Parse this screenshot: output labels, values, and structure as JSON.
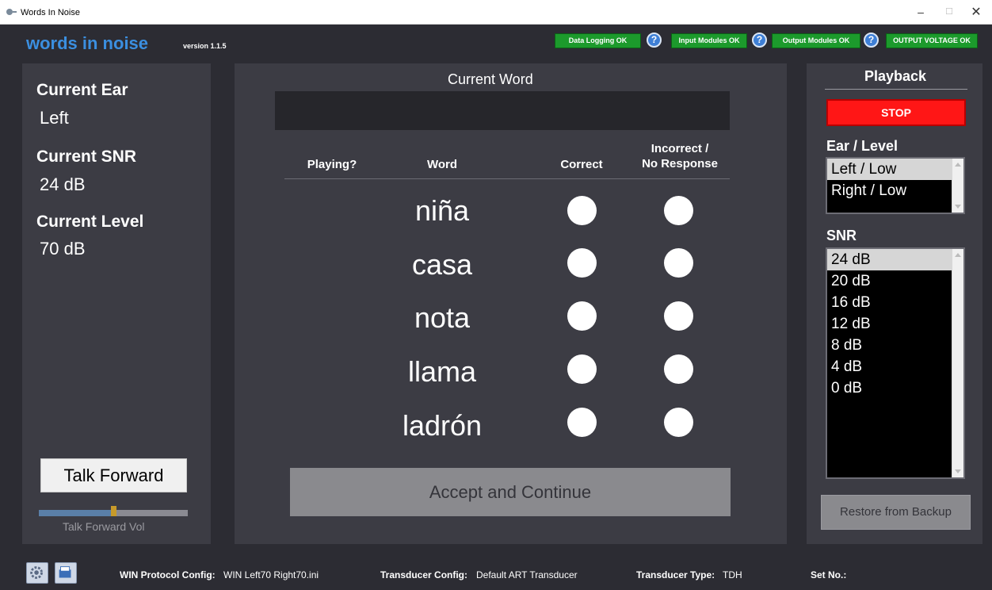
{
  "window": {
    "title": "Words In Noise",
    "minimize": "–",
    "maximize": "☐",
    "close": "✕"
  },
  "header": {
    "app_name": "words in noise",
    "version": "version 1.1.5",
    "status": [
      {
        "label": "Data Logging OK"
      },
      {
        "label": "Input Modules OK"
      },
      {
        "label": "Output Modules OK"
      },
      {
        "label": "OUTPUT VOLTAGE OK"
      }
    ],
    "help_glyph": "?"
  },
  "left": {
    "current_ear_label": "Current  Ear",
    "current_ear_value": "Left",
    "current_snr_label": "Current SNR",
    "current_snr_value": "24 dB",
    "current_level_label": "Current Level",
    "current_level_value": "70 dB",
    "talk_forward_label": "Talk Forward",
    "talk_forward_vol_label": "Talk Forward Vol",
    "talk_forward_vol": 0.5
  },
  "center": {
    "current_word_label": "Current  Word",
    "current_word_value": "",
    "headers": {
      "playing": "Playing?",
      "word": "Word",
      "correct": "Correct",
      "incorrect_line1": "Incorrect /",
      "incorrect_line2": "No Response"
    },
    "words": [
      "niña",
      "casa",
      "nota",
      "llama",
      "ladrón"
    ],
    "accept_label": "Accept and Continue"
  },
  "right": {
    "playback_label": "Playback",
    "stop_label": "STOP",
    "ear_level_label": "Ear / Level",
    "ear_level_options": [
      "Left / Low",
      "Right / Low"
    ],
    "ear_level_selected": 0,
    "snr_label": "SNR",
    "snr_options": [
      "24 dB",
      "20 dB",
      "16 dB",
      "12 dB",
      "8 dB",
      "4 dB",
      "0 dB"
    ],
    "snr_selected": 0,
    "restore_label": "Restore from Backup"
  },
  "footer": {
    "protocol_label": "WIN Protocol Config:",
    "protocol_value": "WIN Left70 Right70.ini",
    "transducer_config_label": "Transducer Config:",
    "transducer_config_value": "Default ART Transducer",
    "transducer_type_label": "Transducer Type:",
    "transducer_type_value": "TDH",
    "set_no_label": "Set No.:",
    "set_no_value": ""
  },
  "colors": {
    "accent": "#3b8fe0",
    "status_ok": "#1c9a2c",
    "stop": "#ff1616",
    "background": "#2c2c33",
    "panel": "#3c3c44"
  }
}
